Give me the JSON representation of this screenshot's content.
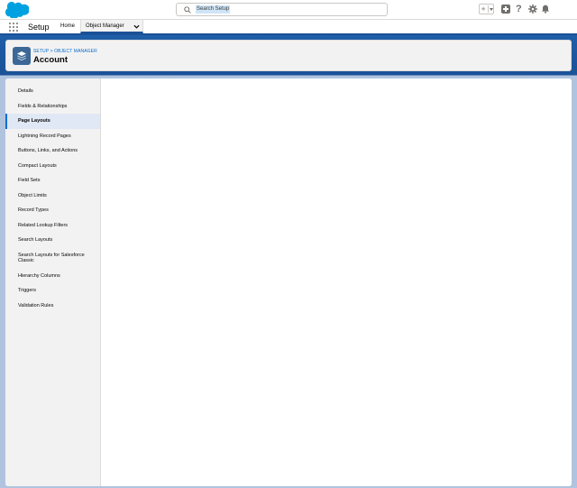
{
  "header": {
    "search_placeholder": "Search Setup",
    "icons": [
      "salesforce-logo",
      "search-icon",
      "favorite-star-icon",
      "chevron-down-icon",
      "add-icon",
      "help-icon",
      "gear-icon",
      "bell-icon"
    ]
  },
  "app_nav": {
    "app_name": "Setup",
    "tabs": [
      {
        "label": "Home"
      },
      {
        "label": "Object Manager",
        "selected": true
      }
    ]
  },
  "page_header": {
    "breadcrumb": "SETUP > OBJECT MANAGER",
    "title": "Account",
    "icon": "layers-icon"
  },
  "sidebar": {
    "items": [
      {
        "label": "Details"
      },
      {
        "label": "Fields & Relationships"
      },
      {
        "label": "Page Layouts",
        "active": true
      },
      {
        "label": "Lightning Record Pages"
      },
      {
        "label": "Buttons, Links, and Actions"
      },
      {
        "label": "Compact Layouts"
      },
      {
        "label": "Field Sets"
      },
      {
        "label": "Object Limits"
      },
      {
        "label": "Record Types"
      },
      {
        "label": "Related Lookup Filters"
      },
      {
        "label": "Search Layouts"
      },
      {
        "label": "Search Layouts for Salesforce Classic"
      },
      {
        "label": "Hierarchy Columns"
      },
      {
        "label": "Triggers"
      },
      {
        "label": "Validation Rules"
      }
    ]
  },
  "colors": {
    "brand_blue": "#1b5297",
    "accent": "#0070d2",
    "active_bg": "#dfe8f4",
    "sidebar_bg": "#f3f2f2"
  }
}
